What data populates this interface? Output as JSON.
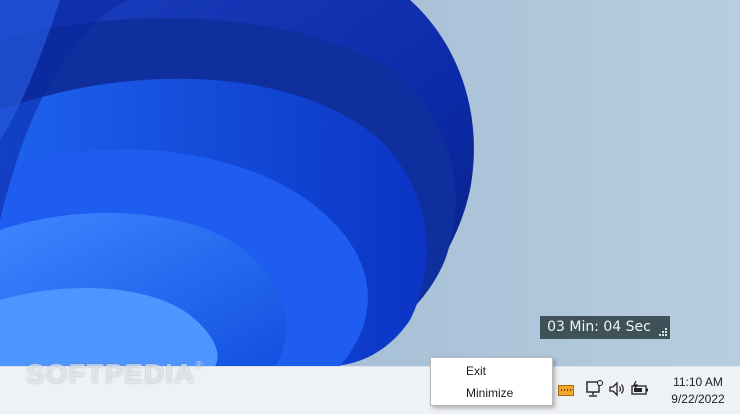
{
  "timer": {
    "text": "03 Min: 04 Sec"
  },
  "watermark": {
    "text": "SOFTPEDIA",
    "mark": "®"
  },
  "context_menu": {
    "items": [
      {
        "label": "Exit"
      },
      {
        "label": "Minimize"
      }
    ]
  },
  "tray": {
    "icons": [
      "timer-app-icon",
      "network-icon",
      "volume-icon",
      "battery-icon"
    ]
  },
  "clock": {
    "time": "11:10 AM",
    "date": "9/22/2022"
  },
  "colors": {
    "wallpaper_blue": "#1450d8",
    "wallpaper_bg": "#a9c2d8",
    "taskbar": "#eef1f5",
    "timer_bg": "#3f5257"
  }
}
